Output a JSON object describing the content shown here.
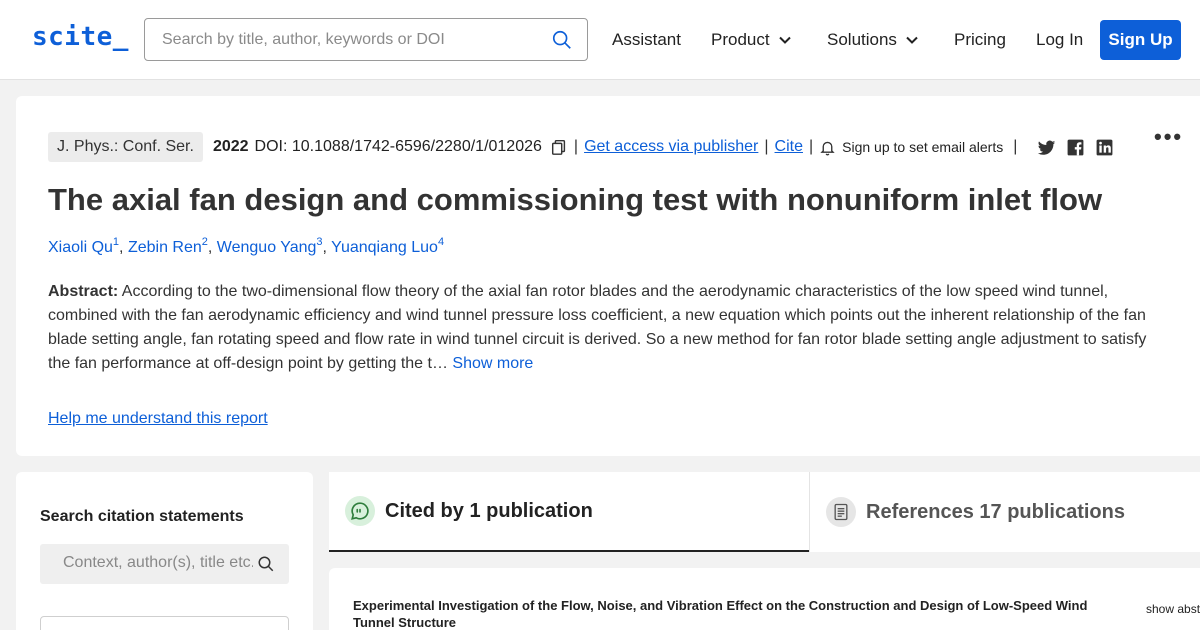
{
  "header": {
    "logo": "scite_",
    "search_placeholder": "Search by title, author, keywords or DOI",
    "nav": {
      "assistant": "Assistant",
      "product": "Product",
      "solutions": "Solutions",
      "pricing": "Pricing",
      "login": "Log In",
      "signup": "Sign Up"
    }
  },
  "paper": {
    "journal": "J. Phys.: Conf. Ser.",
    "year": "2022",
    "doi": "DOI: 10.1088/1742-6596/2280/1/012026",
    "get_access": "Get access via publisher",
    "cite": "Cite",
    "alerts": "Sign up to set email alerts",
    "more": "•••",
    "title": "The axial fan design and commissioning test with nonuniform inlet flow",
    "authors": [
      {
        "name": "Xiaoli Qu",
        "sup": "1"
      },
      {
        "name": "Zebin Ren",
        "sup": "2"
      },
      {
        "name": "Wenguo Yang",
        "sup": "3"
      },
      {
        "name": "Yuanqiang Luo",
        "sup": "4"
      }
    ],
    "abstract_label": "Abstract:",
    "abstract_text": "According to the two-dimensional flow theory of the axial fan rotor blades and the aerodynamic characteristics of the low speed wind tunnel, combined with the fan aerodynamic efficiency and wind tunnel pressure loss coefficient, a new equation which points out the inherent relationship of the fan blade setting angle, fan rotating speed and flow rate in wind tunnel circuit is derived. So a new method for fan rotor blade setting angle adjustment to satisfy the fan performance at off-design point by getting the t…",
    "show_more": "Show more",
    "help": "Help me understand this report"
  },
  "sidebar": {
    "title": "Search citation statements",
    "search_placeholder": "Context, author(s), title etc."
  },
  "tabs": {
    "cited_by": "Cited by 1 publication",
    "references": "References 17 publications"
  },
  "citation": {
    "title": "Experimental Investigation of the Flow, Noise, and Vibration Effect on the Construction and Design of Low-Speed Wind Tunnel Structure",
    "show_abstract": "show abst"
  },
  "colors": {
    "accent": "#0d5fd8",
    "background": "#f2f2f2"
  }
}
